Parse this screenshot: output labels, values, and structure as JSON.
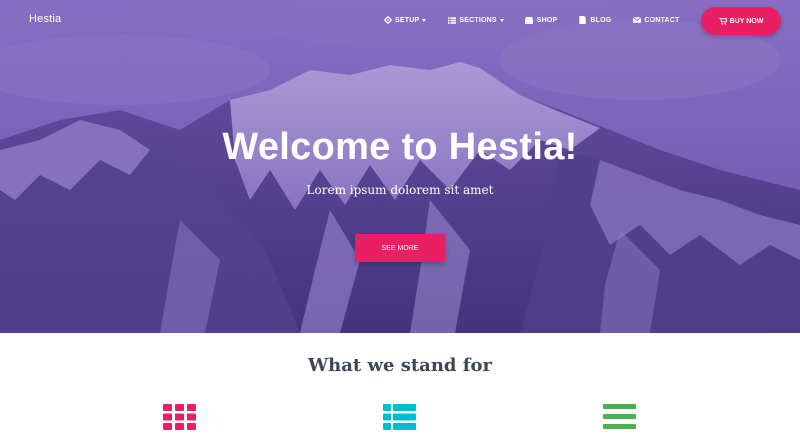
{
  "navbar": {
    "brand": "Hestia",
    "items": [
      {
        "label": "SETUP",
        "icon": "gear-icon",
        "has_dropdown": true
      },
      {
        "label": "SECTIONS",
        "icon": "list-icon",
        "has_dropdown": true
      },
      {
        "label": "SHOP",
        "icon": "shop-icon",
        "has_dropdown": false
      },
      {
        "label": "BLOG",
        "icon": "document-icon",
        "has_dropdown": false
      },
      {
        "label": "CONTACT",
        "icon": "envelope-icon",
        "has_dropdown": false
      }
    ],
    "cta": {
      "label": "BUY NOW",
      "icon": "cart-icon",
      "color": "#e91e63"
    }
  },
  "hero": {
    "title": "Welcome to Hestia!",
    "subtitle": "Lorem ipsum dolorem sit amet",
    "button": "SEE MORE",
    "button_color": "#e91e63"
  },
  "features": {
    "title": "What we stand for",
    "icons": [
      {
        "name": "grid-icon",
        "color": "#e91e63"
      },
      {
        "name": "list-icon",
        "color": "#00bcd4"
      },
      {
        "name": "menu-icon",
        "color": "#4caf50"
      }
    ]
  }
}
